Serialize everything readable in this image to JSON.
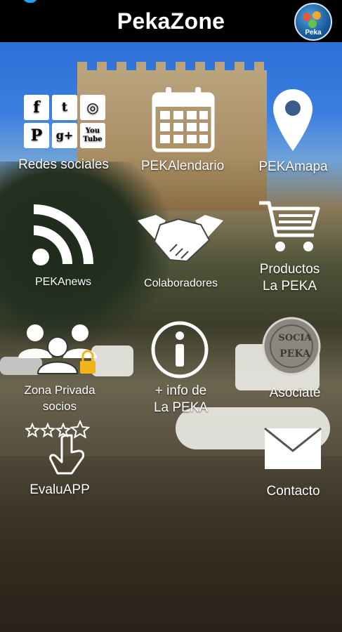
{
  "app": {
    "title": "PekaZone",
    "logo_text": "Peka"
  },
  "tiles": {
    "redes": "Redes sociales",
    "calendario": "PEKAlendario",
    "mapa": "PEKAmapa",
    "news": "PEKAnews",
    "colaboradores": "Colaboradores",
    "productos_line1": "Productos",
    "productos_line2": "La PEKA",
    "zona_line1": "Zona Privada",
    "zona_line2": "socios",
    "info_line1": "+ info de",
    "info_line2": "La PEKA",
    "asociate": "Asociate",
    "evaluapp": "EvaluAPP",
    "contacto": "Contacto"
  },
  "social_icons": {
    "facebook": "f",
    "twitter": "t",
    "instagram": "◎",
    "pinterest": "P",
    "googleplus": "g+",
    "youtube_line1": "You",
    "youtube_line2": "Tube"
  },
  "badge": {
    "top": "SOCIA",
    "bottom": "PEKA"
  }
}
